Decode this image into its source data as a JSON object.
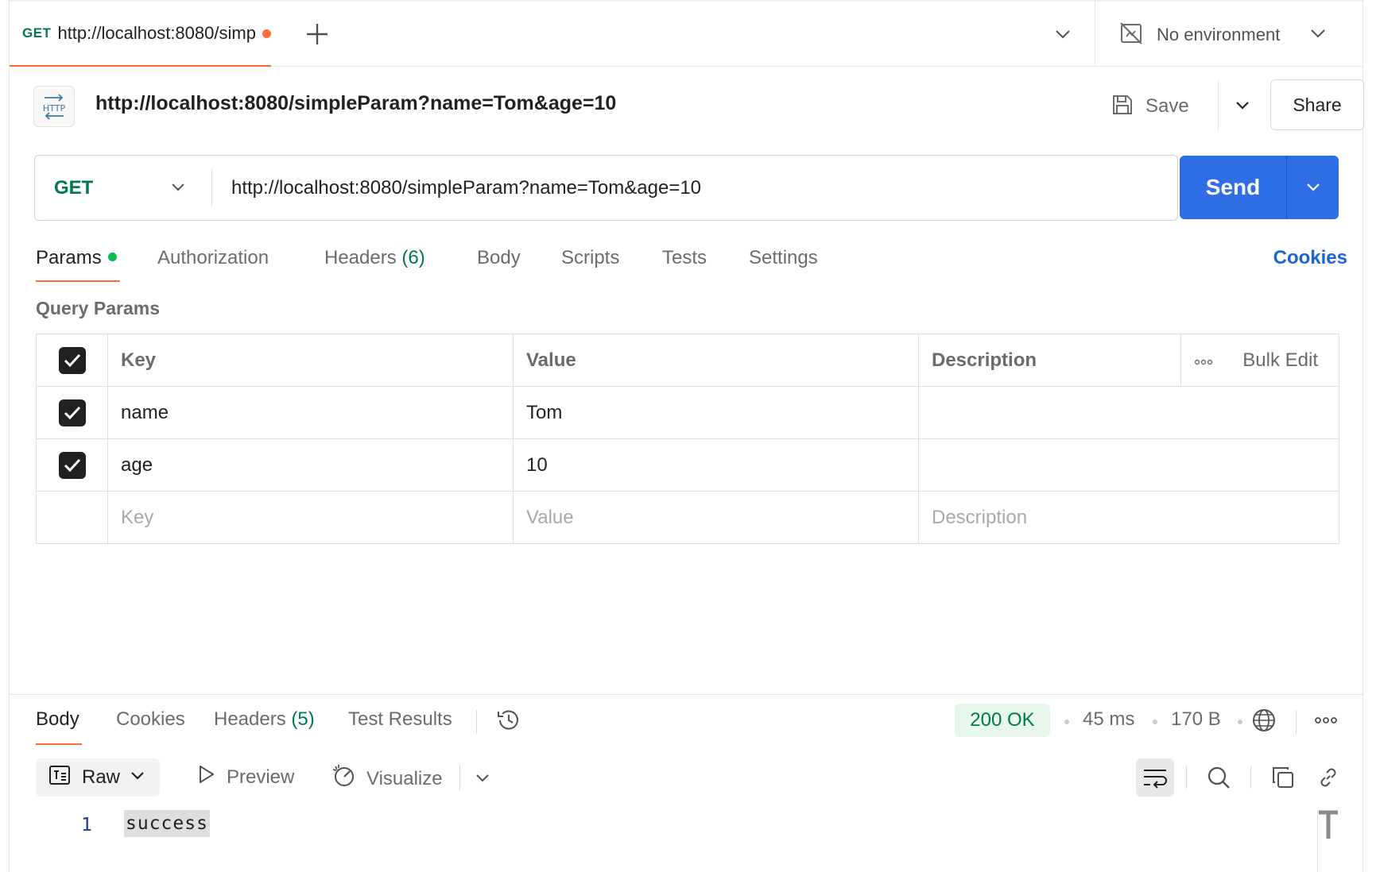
{
  "tabbar": {
    "tab": {
      "method": "GET",
      "title": "http://localhost:8080/simpleParam?name=Tom&age=10"
    },
    "environment": "No environment"
  },
  "request": {
    "name": "http://localhost:8080/simpleParam?name=Tom&age=10",
    "save_label": "Save",
    "share_label": "Share",
    "method": "GET",
    "url": "http://localhost:8080/simpleParam?name=Tom&age=10",
    "send_label": "Send"
  },
  "request_tabs": {
    "params": "Params",
    "authorization": "Authorization",
    "headers": "Headers",
    "headers_count": "(6)",
    "body": "Body",
    "scripts": "Scripts",
    "tests": "Tests",
    "settings": "Settings",
    "cookies": "Cookies"
  },
  "query_params": {
    "title": "Query Params",
    "headers": {
      "key": "Key",
      "value": "Value",
      "description": "Description",
      "bulk_edit": "Bulk Edit"
    },
    "rows": [
      {
        "key": "name",
        "value": "Tom",
        "description": ""
      },
      {
        "key": "age",
        "value": "10",
        "description": ""
      }
    ],
    "placeholders": {
      "key": "Key",
      "value": "Value",
      "description": "Description"
    }
  },
  "response": {
    "tabs": {
      "body": "Body",
      "cookies": "Cookies",
      "headers": "Headers",
      "headers_count": "(5)",
      "test_results": "Test Results"
    },
    "status": "200 OK",
    "time": "45 ms",
    "size": "170 B",
    "toolbar": {
      "format": "Raw",
      "preview": "Preview",
      "visualize": "Visualize"
    },
    "body_lines": [
      {
        "number": "1",
        "text": "success"
      }
    ]
  },
  "colors": {
    "accent": "#ff6c37",
    "send_button": "#2d6ee6",
    "method_get": "#00794a",
    "status_ok_bg": "#e7f7ec",
    "link": "#1d63d8"
  }
}
